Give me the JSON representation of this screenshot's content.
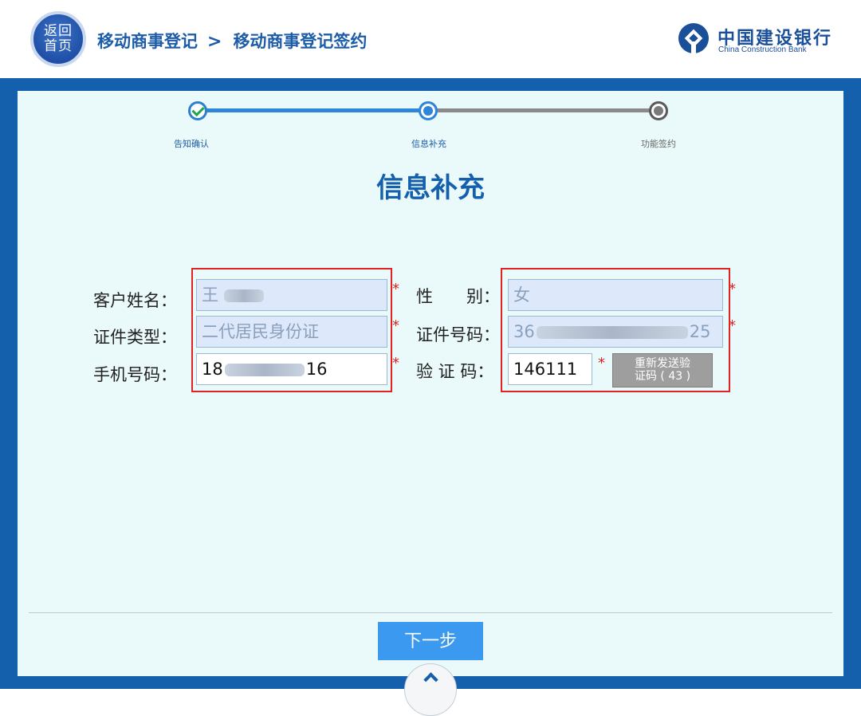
{
  "header": {
    "home_label_line1": "返回",
    "home_label_line2": "首页",
    "breadcrumb_1": "移动商事登记",
    "breadcrumb_sep": ">",
    "breadcrumb_2": "移动商事登记签约",
    "logo_cn": "中国建设银行",
    "logo_en": "China Construction Bank"
  },
  "stepper": {
    "steps": [
      {
        "label": "告知确认",
        "status": "done"
      },
      {
        "label": "信息补充",
        "status": "current"
      },
      {
        "label": "功能签约",
        "status": "todo"
      }
    ]
  },
  "page_title": "信息补充",
  "form": {
    "name_label": "客户姓名：",
    "name_value": "王",
    "id_type_label": "证件类型：",
    "id_type_value": "二代居民身份证",
    "phone_label": "手机号码：",
    "phone_prefix": "18",
    "phone_suffix": "16",
    "gender_label": "性　　别：",
    "gender_value": "女",
    "id_no_label": "证件号码：",
    "id_no_prefix": "36",
    "id_no_suffix": "25",
    "code_label": "验 证 码：",
    "code_value": "146111",
    "required_mark": "*",
    "resend_line1": "重新发送验",
    "resend_line2": "证码 ( 43 )"
  },
  "next_button": "下一步",
  "colors": {
    "brand_blue": "#1560ad",
    "panel_bg": "#eaf9f9",
    "highlight_red": "#e02222",
    "button_blue": "#3b9af0"
  }
}
